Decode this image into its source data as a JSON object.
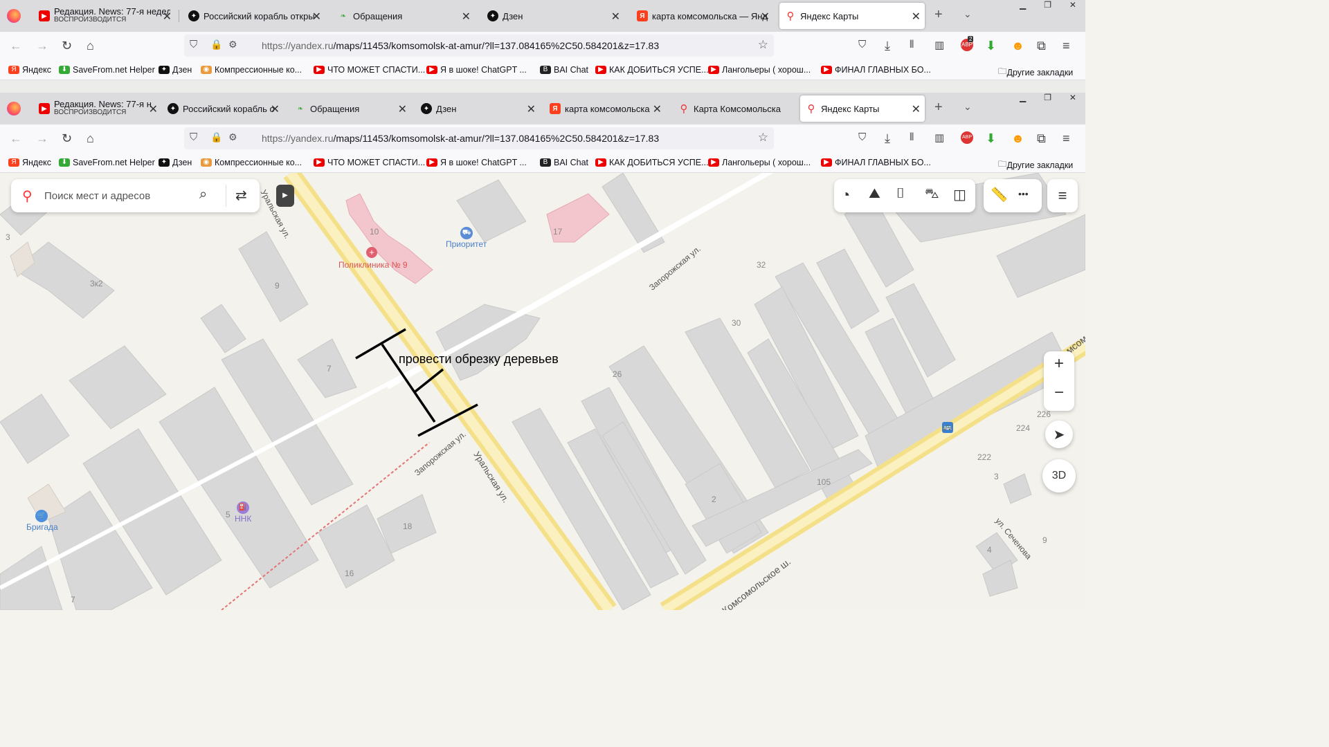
{
  "browser_back": {
    "tabs": [
      {
        "title": "Редакция. News: 77-я недел",
        "subtitle": "ВОСПРОИЗВОДИТСЯ",
        "icon": "youtube-icon"
      },
      {
        "title": "Российский корабль откры",
        "icon": "dzen-icon"
      },
      {
        "title": "Обращения",
        "icon": "leaf-icon"
      },
      {
        "title": "Дзен",
        "icon": "dzen-icon"
      },
      {
        "title": "карта комсомольска — Янд",
        "icon": "yandex-icon"
      },
      {
        "title": "Яндекс Карты",
        "icon": "map-pin-icon"
      }
    ],
    "url_domain": "https://yandex.ru",
    "url_path": "/maps/11453/komsomolsk-at-amur/?ll=137.084165%2C50.584201&z=17.83",
    "abp_badge": "2"
  },
  "browser_front": {
    "tabs": [
      {
        "title": "Редакция. News: 77-я н",
        "subtitle": "ВОСПРОИЗВОДИТСЯ",
        "icon": "youtube-icon"
      },
      {
        "title": "Российский корабль о",
        "icon": "dzen-icon"
      },
      {
        "title": "Обращения",
        "icon": "leaf-icon"
      },
      {
        "title": "Дзен",
        "icon": "dzen-icon"
      },
      {
        "title": "карта комсомольска",
        "icon": "yandex-icon"
      },
      {
        "title": "Карта Комсомольска",
        "icon": "map-pin-icon"
      },
      {
        "title": "Яндекс Карты",
        "icon": "map-pin-icon"
      }
    ],
    "url_domain": "https://yandex.ru",
    "url_path": "/maps/11453/komsomolsk-at-amur/?ll=137.084165%2C50.584201&z=17.83",
    "abp_badge": "ABP"
  },
  "bookmarks": [
    "Яндекс",
    "SaveFrom.net Helper",
    "Дзен",
    "Компрессионные ко...",
    "ЧТО МОЖЕТ СПАСТИ...",
    "Я в шоке! ChatGPT ...",
    "BAI Chat",
    "КАК ДОБИТЬСЯ УСПЕ...",
    "Лангольеры ( хорош...",
    "ФИНАЛ ГЛАВНЫХ БО..."
  ],
  "other_bookmarks": "Другие закладки",
  "map": {
    "search_placeholder": "Поиск мест и адресов",
    "annotation": "провести обрезку деревьев",
    "streets": {
      "uralskaya_top": "Уральская ул.",
      "uralskaya": "Уральская ул.",
      "zaporozhskaya_top": "Запорожская ул.",
      "zaporozhskaya": "Запорожская ул.",
      "komsomol_sh": "Комсомольское ш.",
      "komsom_top": "Комсом",
      "sechenova": "ул. Сеченова"
    },
    "pois": {
      "polyclinic": "Поликлиника № 9",
      "prioritet": "Приоритет",
      "nnk": "ННК",
      "brigada": "Бригада"
    },
    "houses": {
      "h10": "10",
      "h17": "17",
      "h3": "3",
      "h3k2": "3к2",
      "h9": "9",
      "h7": "7",
      "h32": "32",
      "h30": "30",
      "h26": "26",
      "h226": "226",
      "h224": "224",
      "h222": "222",
      "h3b": "3",
      "h105": "105",
      "h2": "2",
      "h18": "18",
      "h16": "16",
      "h5": "5",
      "h7b": "7",
      "h4": "4",
      "h9b": "9"
    },
    "controls": {
      "zoom_in": "+",
      "zoom_out": "−",
      "three_d": "3D",
      "more": "•••"
    }
  }
}
